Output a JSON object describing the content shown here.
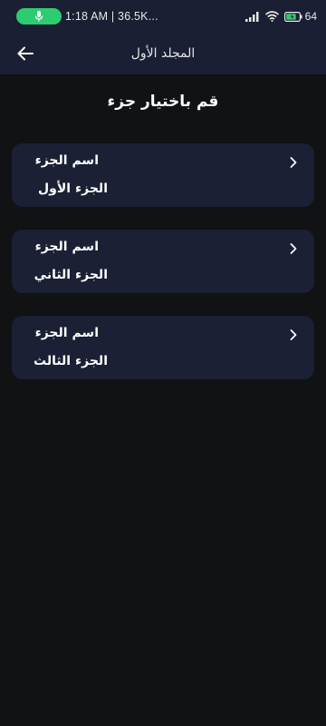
{
  "status_bar": {
    "time_text": "1:18 AM | 36.5K...",
    "battery_text": "64",
    "icons": [
      "microphone-icon",
      "signal-icon",
      "wifi-icon",
      "battery-icon"
    ]
  },
  "app_bar": {
    "title": "المجلد الأول",
    "back_icon": "arrow-left-icon"
  },
  "heading": "قم باختيار جزء",
  "parts": [
    {
      "label": "اسم الجزء",
      "name": "الجزء الأول"
    },
    {
      "label": "اسم الجزء",
      "name": "الجزء الثاني"
    },
    {
      "label": "اسم الجزء",
      "name": "الجزء الثالث"
    }
  ],
  "colors": {
    "background": "#111214",
    "bar": "#1a1f33",
    "card": "#1b2034",
    "mic_pill": "#2ecc71"
  }
}
